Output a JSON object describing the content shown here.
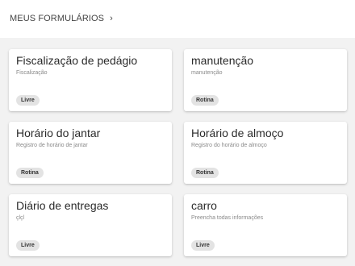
{
  "breadcrumb": {
    "label": "MEUS FORMULÁRIOS",
    "chevron": "›",
    "chevron_icon": "chevron-right-icon"
  },
  "forms": [
    {
      "title": "Fiscalização de pedágio",
      "subtitle": "Fiscalização",
      "tag": "Livre"
    },
    {
      "title": "manutenção",
      "subtitle": "manutenção",
      "tag": "Rotina"
    },
    {
      "title": "Horário do jantar",
      "subtitle": "Registro de horário de jantar",
      "tag": "Rotina"
    },
    {
      "title": "Horário de almoço",
      "subtitle": "Registro do horário de almoço",
      "tag": "Rotina"
    },
    {
      "title": "Diário de entregas",
      "subtitle": "çlçl",
      "tag": "Livre"
    },
    {
      "title": "carro",
      "subtitle": "Preencha todas informações",
      "tag": "Livre"
    }
  ]
}
